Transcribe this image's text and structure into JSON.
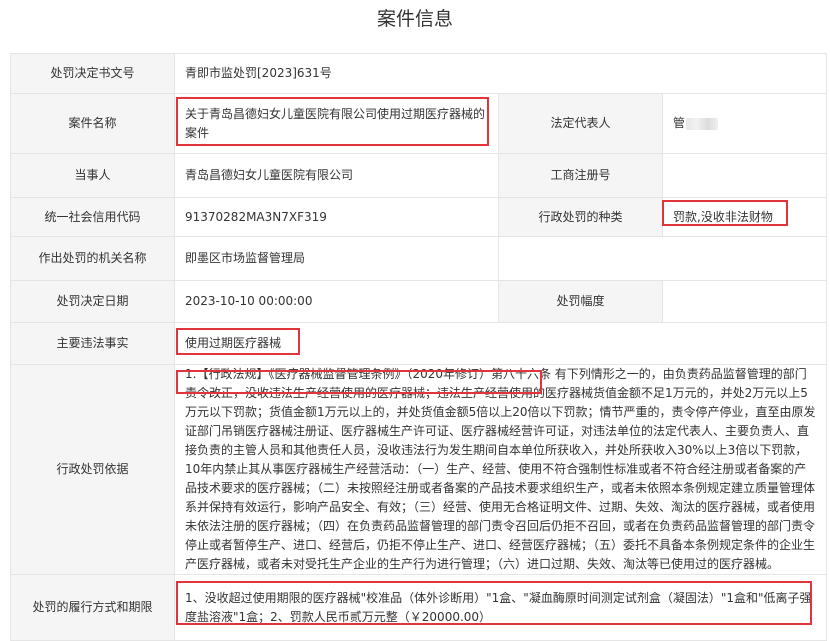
{
  "page": {
    "title": "案件信息"
  },
  "rows": {
    "decision_no": {
      "label": "处罚决定书文号",
      "value": "青即市监处罚[2023]631号"
    },
    "case_name": {
      "label": "案件名称",
      "value": "关于青岛昌德妇女儿童医院有限公司使用过期医疗器械的案件"
    },
    "legal_rep": {
      "label": "法定代表人",
      "value": "管"
    },
    "party": {
      "label": "当事人",
      "value": "青岛昌德妇女儿童医院有限公司"
    },
    "reg_no": {
      "label": "工商注册号",
      "value": ""
    },
    "credit_code": {
      "label": "统一社会信用代码",
      "value": "91370282MA3N7XF319"
    },
    "penalty_type": {
      "label": "行政处罚的种类",
      "value": "罚款,没收非法财物"
    },
    "authority": {
      "label": "作出处罚的机关名称",
      "value": "即墨区市场监督管理局"
    },
    "decision_date": {
      "label": "处罚决定日期",
      "value": "2023-10-10 00:00:00"
    },
    "penalty_range": {
      "label": "处罚幅度",
      "value": ""
    },
    "main_facts": {
      "label": "主要违法事实",
      "value": "使用过期医疗器械"
    },
    "basis": {
      "label": "行政处罚依据",
      "value": "1.【行政法规】《医疗器械监督管理条例》（2020年修订）第八十六条 有下列情形之一的，由负责药品监督管理的部门责令改正，没收违法生产经营使用的医疗器械；违法生产经营使用的医疗器械货值金额不足1万元的，并处2万元以上5万元以下罚款；货值金额1万元以上的，并处货值金额5倍以上20倍以下罚款；情节严重的，责令停产停业，直至由原发证部门吊销医疗器械注册证、医疗器械生产许可证、医疗器械经营许可证，对违法单位的法定代表人、主要负责人、直接负责的主管人员和其他责任人员，没收违法行为发生期间自本单位所获收入，并处所获收入30%以上3倍以下罚款，10年内禁止其从事医疗器械生产经营活动：（一）生产、经营、使用不符合强制性标准或者不符合经注册或者备案的产品技术要求的医疗器械；（二）未按照经注册或者备案的产品技术要求组织生产，或者未依照本条例规定建立质量管理体系并保持有效运行，影响产品安全、有效；（三）经营、使用无合格证明文件、过期、失效、淘汰的医疗器械，或者使用未依法注册的医疗器械；（四）在负责药品监督管理的部门责令召回后仍拒不召回，或者在负责药品监督管理的部门责令停止或者暂停生产、进口、经营后，仍拒不停止生产、进口、经营医疗器械；（五）委托不具备本条例规定条件的企业生产医疗器械，或者未对受托生产企业的生产行为进行管理；（六）进口过期、失效、淘汰等已使用过的医疗器械。"
    },
    "execution": {
      "label": "处罚的履行方式和期限",
      "value": "1、没收超过使用期限的医疗器械\"校准品（体外诊断用）\"1盒、\"凝血酶原时间测定试剂盒（凝固法）\"1盒和\"低离子强度盐溶液\"1盒；2、罚款人民币贰万元整（￥20000.00）"
    }
  },
  "highlight_color": "#e4343b"
}
